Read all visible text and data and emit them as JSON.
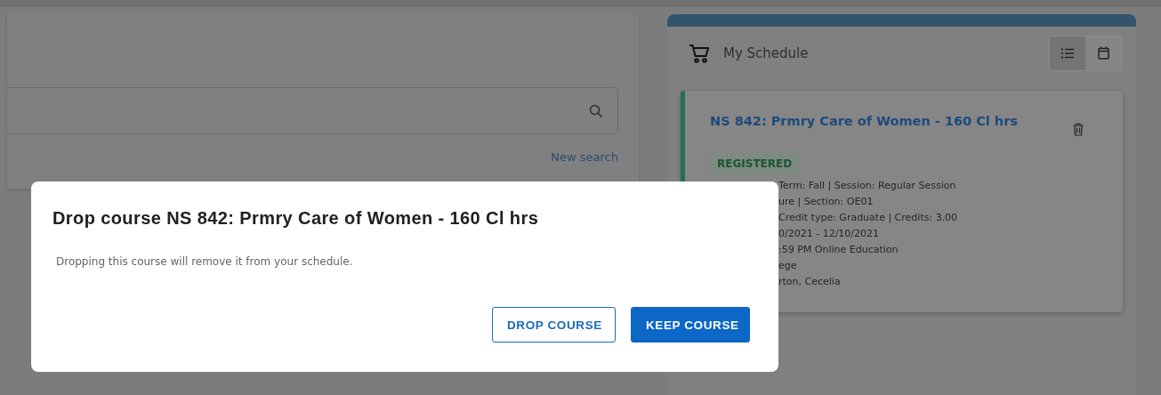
{
  "search_panel": {
    "new_search_link": "New search"
  },
  "schedule": {
    "title": "My Schedule",
    "view_toggle": [
      {
        "kind": "list",
        "selected": true
      },
      {
        "kind": "calendar",
        "selected": false
      }
    ],
    "courses": [
      {
        "title": "NS 842: Prmry Care of Women - 160 Cl hrs",
        "status": "REGISTERED",
        "details": [
          "Term: Fall | Session: Regular Session",
          "ure | Section: OE01",
          "Credit type: Graduate | Credits: 3.00",
          "0/2021 - 12/10/2021",
          ":59 PM Online Education",
          "ege",
          "rton, Cecelia"
        ]
      }
    ]
  },
  "dialog": {
    "title": "Drop course NS 842: Prmry Care of Women - 160 Cl hrs",
    "message": "Dropping this course will remove it from your schedule.",
    "buttons": [
      {
        "label": "DROP COURSE",
        "kind": "outline"
      },
      {
        "label": "KEEP COURSE",
        "kind": "primary"
      }
    ]
  }
}
